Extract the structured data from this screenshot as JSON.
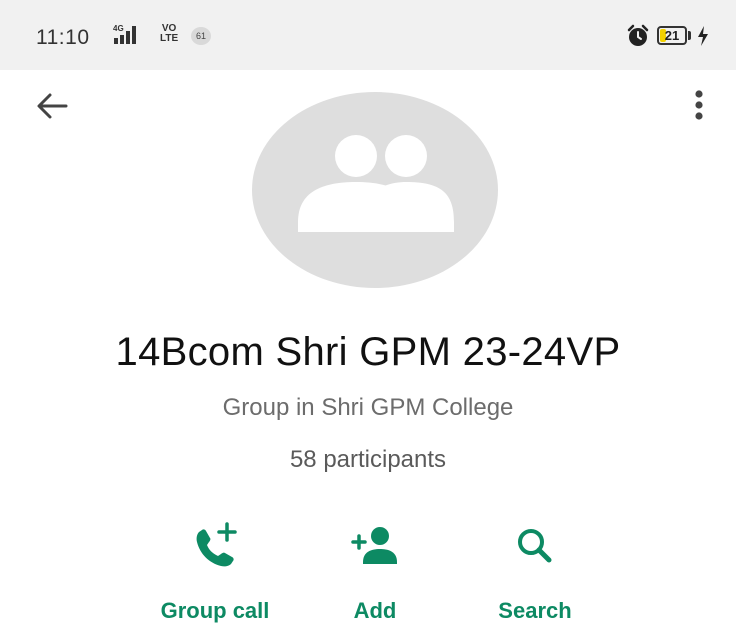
{
  "status_bar": {
    "time": "11:10",
    "network": "4G",
    "volte_top": "VO",
    "volte_bottom": "LTE",
    "notification_count": "61",
    "battery_level": "21",
    "battery_fill_color": "#f2d100",
    "icons": [
      "signal-icon",
      "alarm-icon",
      "battery-icon",
      "charging-icon"
    ]
  },
  "app_bar": {
    "back_icon": "arrow-left-icon",
    "menu_icon": "more-vert-icon"
  },
  "group": {
    "name": "14Bcom Shri GPM 23-24VP",
    "subtitle": "Group in Shri GPM College",
    "participants": "58 participants",
    "avatar_icon": "group-avatar-icon"
  },
  "actions": [
    {
      "label": "Group call",
      "icon": "add-call-icon"
    },
    {
      "label": "Add",
      "icon": "person-add-icon"
    },
    {
      "label": "Search",
      "icon": "search-icon"
    }
  ],
  "colors": {
    "accent": "#0d8a63",
    "avatar_bg": "#dedede",
    "status_bar_bg": "#f1f1f1"
  }
}
